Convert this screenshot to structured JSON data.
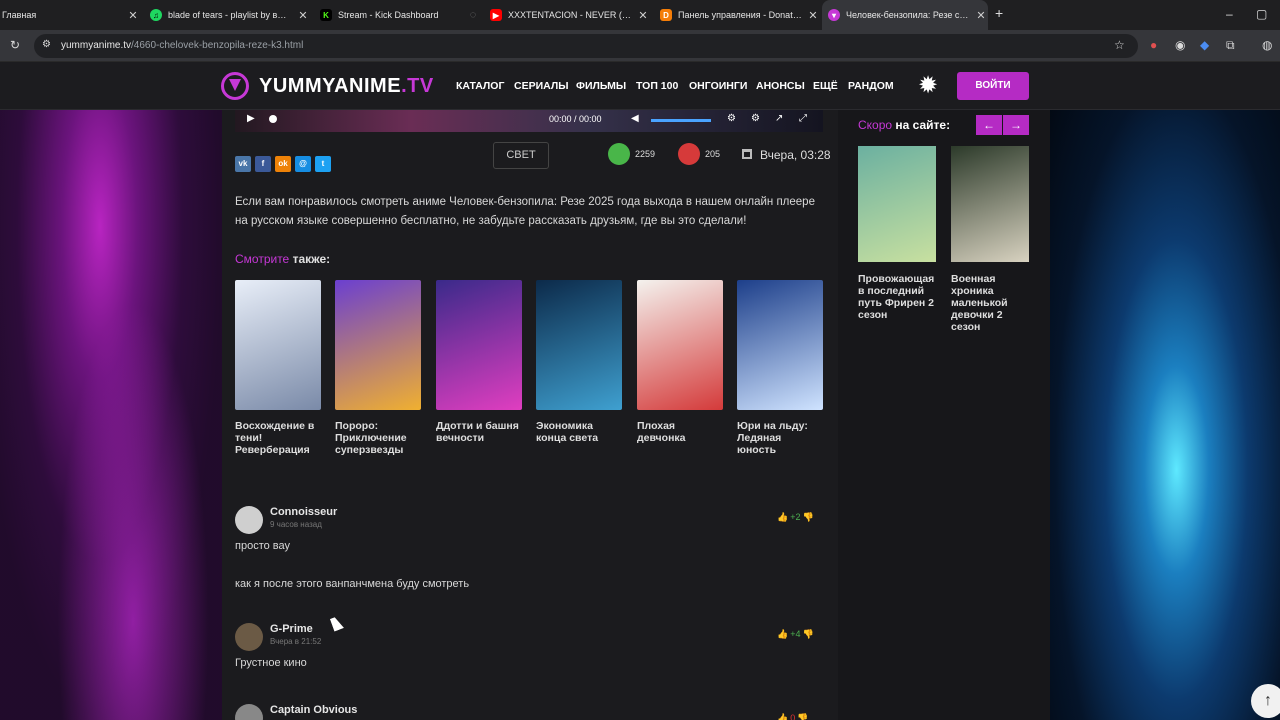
{
  "browser": {
    "tabs": [
      {
        "title": "Главная",
        "favicon_color": "#ffffff",
        "active": false
      },
      {
        "title": "blade of tears - playlist by выбо",
        "favicon_color": "#1ed760",
        "active": false
      },
      {
        "title": "Stream - Kick Dashboard",
        "favicon_color": "#53fc18",
        "active": false
      },
      {
        "title": "XXXTENTACION - NEVER (Offici",
        "favicon_color": "#ff0000",
        "active": false
      },
      {
        "title": "Панель управления - Donation",
        "favicon_color": "#f57d07",
        "active": false
      },
      {
        "title": "Человек-бензопила: Резе смо",
        "favicon_color": "#c638d6",
        "active": true
      }
    ],
    "new_tab_label": "+",
    "url_host": "yummyanime.tv",
    "url_path": "/4660-chelovek-benzopila-reze-k3.html"
  },
  "site": {
    "logo_text": "YUMMYANIME",
    "logo_tld": ".TV",
    "nav": [
      "КАТАЛОГ",
      "СЕРИАЛЫ",
      "ФИЛЬМЫ",
      "ТОП 100",
      "ОНГОИНГИ",
      "АНОНСЫ",
      "ЕЩЁ",
      "РАНДОМ"
    ],
    "login_label": "ВОЙТИ",
    "accent_color": "#c638d6"
  },
  "player": {
    "time": "00:00 / 00:00"
  },
  "share_row": {
    "buttons": [
      {
        "name": "vk",
        "label": "vk",
        "color": "#4a76a8"
      },
      {
        "name": "facebook",
        "label": "f",
        "color": "#3b5998"
      },
      {
        "name": "odnoklassniki",
        "label": "ok",
        "color": "#ee8208"
      },
      {
        "name": "mailru",
        "label": "@",
        "color": "#168de2"
      },
      {
        "name": "twitter",
        "label": "t",
        "color": "#1da1f2"
      }
    ],
    "light_label": "СВЕТ",
    "likes": "2259",
    "dislikes": "205",
    "date": "Вчера, 03:28"
  },
  "description": "Если вам понравилось смотреть аниме Человек-бензопила: Резе 2025 года выхода в нашем онлайн плеере на русском языке совершенно бесплатно, не забудьте рассказать друзьям, где вы это сделали!",
  "see_also": {
    "title_accent": "Смотрите",
    "title_rest": " также:",
    "items": [
      {
        "title": "Восхождение в тени! Реверберация",
        "colors": [
          "#e8eef8",
          "#7a8aa8"
        ]
      },
      {
        "title": "Пороро: Приключение суперзвезды",
        "colors": [
          "#6b3fd0",
          "#f0b030"
        ]
      },
      {
        "title": "Ддотти и башня вечности",
        "colors": [
          "#3a2a8a",
          "#e03ec0"
        ]
      },
      {
        "title": "Экономика конца света",
        "colors": [
          "#0c2a4a",
          "#3fa0d0"
        ]
      },
      {
        "title": "Плохая девчонка",
        "colors": [
          "#f4f2ee",
          "#d43a3a"
        ]
      },
      {
        "title": "Юри на льду: Ледяная юность",
        "colors": [
          "#1d3f8a",
          "#cfe3ff"
        ]
      }
    ]
  },
  "comments": [
    {
      "author": "Connoisseur",
      "time": "9 часов назад",
      "score": "+2",
      "score_color": "#4caf50",
      "lines": [
        "просто вау",
        "как я после этого ванпанчмена буду смотреть"
      ],
      "avatar_color": "#cfcfcf"
    },
    {
      "author": "G-Prime",
      "time": "Вчера в 21:52",
      "score": "+4",
      "score_color": "#4caf50",
      "lines": [
        "Грустное кино"
      ],
      "avatar_color": "#6b5a45"
    },
    {
      "author": "Captain Obvious",
      "time": "",
      "score": "0",
      "score_color": "#dd3333",
      "lines": [],
      "avatar_color": "#888888"
    }
  ],
  "sidebar": {
    "soon_accent": "Скоро",
    "soon_rest": " на сайте:",
    "prev_label": "←",
    "next_label": "→",
    "items": [
      {
        "title": "Провожающая в последний путь Фрирен 2 сезон",
        "colors": [
          "#6bb0a0",
          "#c8e0a0"
        ]
      },
      {
        "title": "Военная хроника маленькой девочки 2 сезон",
        "colors": [
          "#2c3a2a",
          "#d8d2c0"
        ]
      }
    ]
  },
  "icons": [
    "logo-icon",
    "sun-icon",
    "play-icon",
    "volume-icon",
    "settings-icon",
    "fullscreen-icon",
    "thumbs-up-icon",
    "thumbs-down-icon",
    "calendar-icon",
    "arrow-up-icon"
  ]
}
